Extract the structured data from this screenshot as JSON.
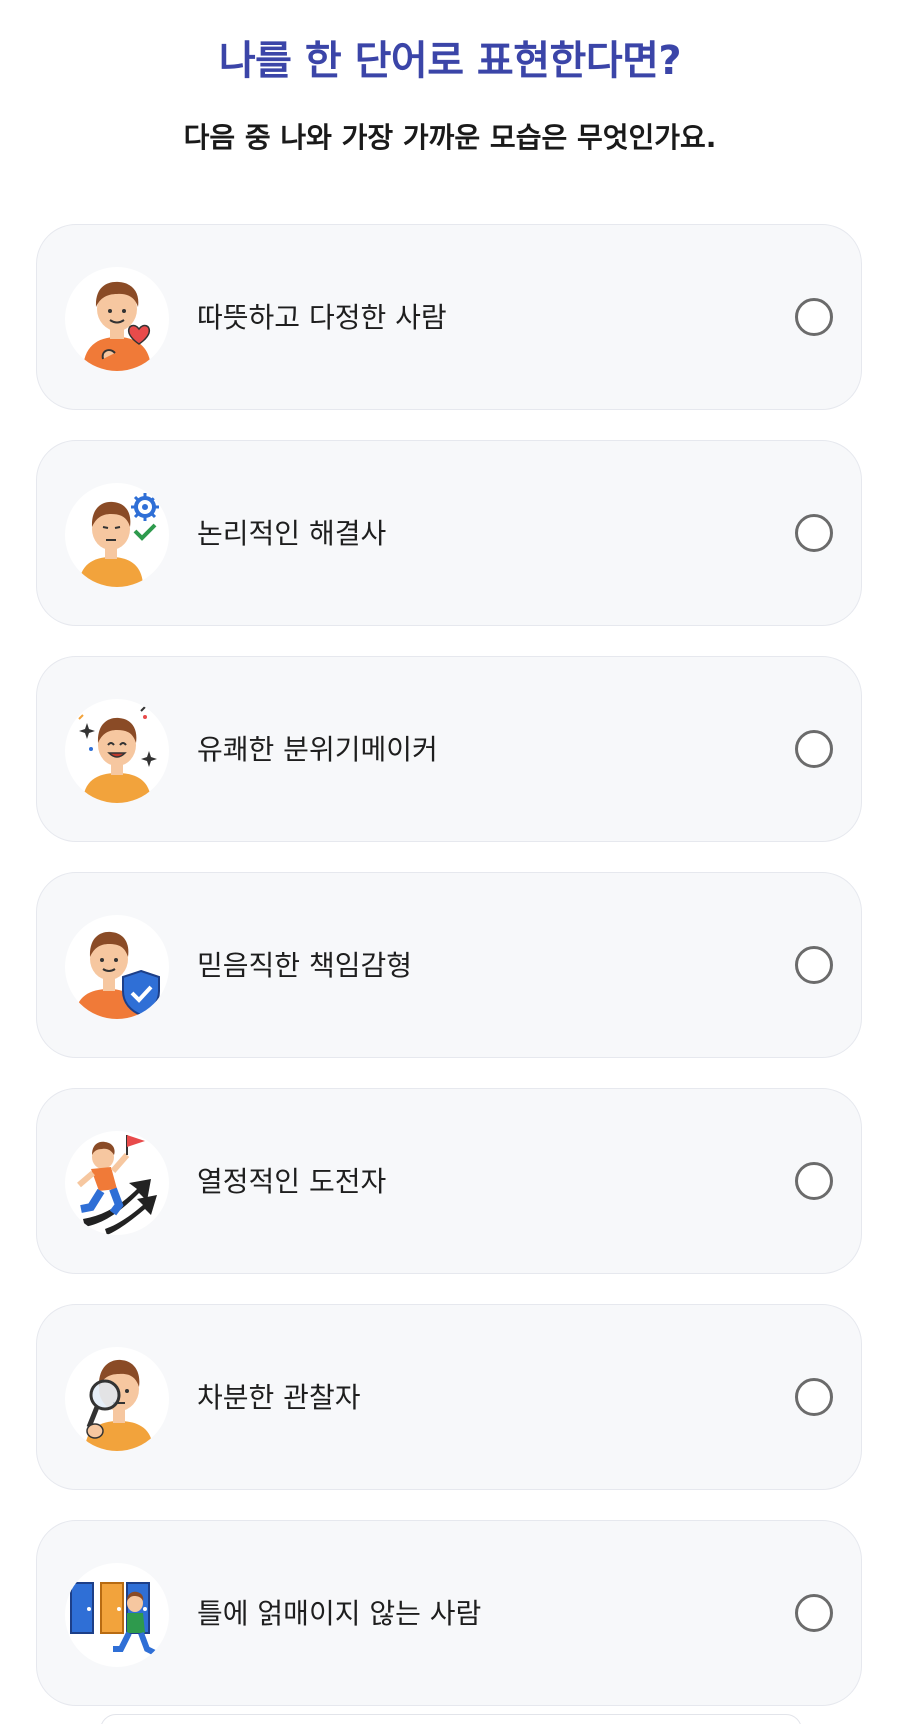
{
  "header": {
    "title": "나를 한 단어로 표현한다면?",
    "subtitle": "다음 중 나와 가장 가까운 모습은 무엇인가요."
  },
  "options": [
    {
      "label": "따뜻하고 다정한 사람",
      "icon": "warm-person-heart-icon",
      "selected": false
    },
    {
      "label": "논리적인 해결사",
      "icon": "logical-solver-gear-check-icon",
      "selected": false
    },
    {
      "label": "유쾌한 분위기메이커",
      "icon": "cheerful-sparkles-icon",
      "selected": false
    },
    {
      "label": "믿음직한 책임감형",
      "icon": "reliable-shield-check-icon",
      "selected": false
    },
    {
      "label": "열정적인 도전자",
      "icon": "climber-flag-arrow-icon",
      "selected": false
    },
    {
      "label": "차분한 관찰자",
      "icon": "observer-magnifier-icon",
      "selected": false
    },
    {
      "label": "틀에 얽매이지 않는 사람",
      "icon": "free-spirit-doors-icon",
      "selected": false
    }
  ],
  "colors": {
    "title": "#3b45a8",
    "card_bg": "#f7f8fa",
    "radio_border": "#6b6b6b",
    "skin": "#f6c7a0",
    "hair": "#8a4b26",
    "shirt_orange": "#f07a38",
    "shirt_amber": "#f2a33c",
    "accent_blue": "#2f6fd6"
  }
}
